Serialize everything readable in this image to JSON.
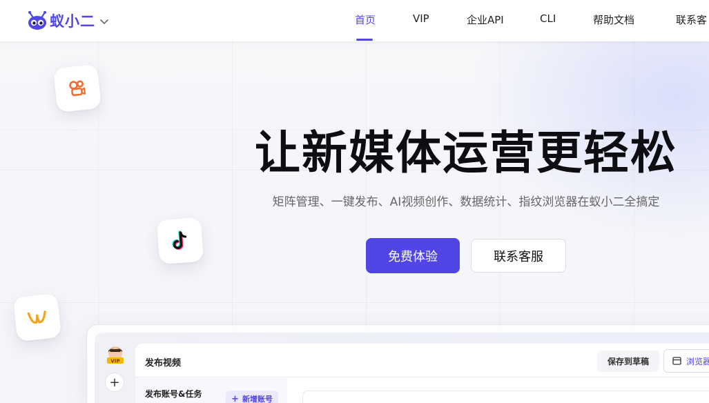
{
  "brand": {
    "name": "蚁小二",
    "accent": "#4f46e5"
  },
  "nav": {
    "items": [
      {
        "label": "首页",
        "active": true
      },
      {
        "label": "VIP",
        "active": false
      },
      {
        "label": "企业API",
        "active": false
      },
      {
        "label": "CLI",
        "active": false
      },
      {
        "label": "帮助文档",
        "active": false
      },
      {
        "label": "联系客",
        "active": false
      }
    ]
  },
  "hero": {
    "title": "让新媒体运营更轻松",
    "subtitle": "矩阵管理、一键发布、AI视频创作、数据统计、指纹浏览器在蚁小二全搞定",
    "primary_button": "免费体验",
    "secondary_button": "联系客服"
  },
  "floating_icons": [
    "kuaishou-icon",
    "douyin-icon",
    "weibo-video-icon"
  ],
  "preview": {
    "panel_title": "发布视频",
    "save_draft": "保存到草稿",
    "preview_label": "浏览器",
    "left_title": "发布账号&任务",
    "add_account": "新增账号",
    "avatar_badge": "VIP"
  }
}
